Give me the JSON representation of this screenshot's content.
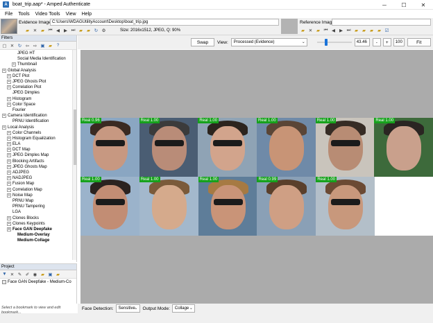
{
  "window": {
    "title": "boat_trip.aap* - Amped Authenticate",
    "logo": "A"
  },
  "menu": [
    "File",
    "Tools",
    "Video Tools",
    "View",
    "Help"
  ],
  "evidence": {
    "label": "Evidence Image:",
    "path": "C:\\Users\\WDAGUtilityAccount\\Desktop\\boat_trip.jpg",
    "size_info": "Size: 2016x1512, JPEG, Q: 90%"
  },
  "reference": {
    "label": "Reference Image:"
  },
  "filters": {
    "header": "Filters",
    "tree": [
      {
        "label": "JPEG HT",
        "level": 2,
        "exp": false
      },
      {
        "label": "Social Media Identification",
        "level": 2,
        "exp": false
      },
      {
        "label": "Thumbnail",
        "level": 2,
        "exp": true
      },
      {
        "label": "Global Analysis",
        "level": 0,
        "exp": true
      },
      {
        "label": "DCT Plot",
        "level": 1,
        "exp": true
      },
      {
        "label": "JPEG Ghosts Plot",
        "level": 1,
        "exp": true
      },
      {
        "label": "Correlation Plot",
        "level": 1,
        "exp": true
      },
      {
        "label": "JPEG Dimples",
        "level": 1,
        "exp": false
      },
      {
        "label": "Histogram",
        "level": 1,
        "exp": true
      },
      {
        "label": "Color Space",
        "level": 1,
        "exp": true
      },
      {
        "label": "Fourier",
        "level": 1,
        "exp": false
      },
      {
        "label": "Camera Identification",
        "level": 0,
        "exp": true
      },
      {
        "label": "PRNU Identification",
        "level": 1,
        "exp": false
      },
      {
        "label": "Local Analysis",
        "level": 0,
        "exp": true
      },
      {
        "label": "Color Channels",
        "level": 1,
        "exp": true
      },
      {
        "label": "Histogram Equalization",
        "level": 1,
        "exp": true
      },
      {
        "label": "ELA",
        "level": 1,
        "exp": true
      },
      {
        "label": "DCT Map",
        "level": 1,
        "exp": true
      },
      {
        "label": "JPEG Dimples Map",
        "level": 1,
        "exp": true
      },
      {
        "label": "Blocking Artifacts",
        "level": 1,
        "exp": true
      },
      {
        "label": "JPEG Ghosts Map",
        "level": 1,
        "exp": true
      },
      {
        "label": "ADJPEG",
        "level": 1,
        "exp": true
      },
      {
        "label": "NADJPEG",
        "level": 1,
        "exp": true
      },
      {
        "label": "Fusion Map",
        "level": 1,
        "exp": true
      },
      {
        "label": "Correlation Map",
        "level": 1,
        "exp": true
      },
      {
        "label": "Noise Map",
        "level": 1,
        "exp": true
      },
      {
        "label": "PRNU Map",
        "level": 1,
        "exp": false
      },
      {
        "label": "PRNU Tampering",
        "level": 1,
        "exp": false
      },
      {
        "label": "LGA",
        "level": 1,
        "exp": false
      },
      {
        "label": "Clones Blocks",
        "level": 1,
        "exp": true
      },
      {
        "label": "Clones Keypoints",
        "level": 1,
        "exp": true
      },
      {
        "label": "Face GAN Deepfake",
        "level": 1,
        "exp": true,
        "bold": true
      },
      {
        "label": "Medium-Overlay",
        "level": 2,
        "exp": false,
        "bold": true
      },
      {
        "label": "Medium-Collage",
        "level": 2,
        "exp": false,
        "bold": true
      }
    ]
  },
  "project": {
    "header": "Project",
    "item": "Face GAN Deepfake - Medium-Co",
    "hint": "Select a bookmark to view and edit bookmark..."
  },
  "view_toolbar": {
    "swap": "Swap",
    "view_label": "View:",
    "view_value": "Processed (Evidence)",
    "zoom": "43.46",
    "minus": "-",
    "plus": "+",
    "pct": "100",
    "fit": "Fit",
    "zoom_level": 0.25
  },
  "faces": [
    {
      "label": "Real 0.96",
      "skin": "#c79881",
      "hair": "#3a2a22",
      "glasses": true,
      "bg": "#8aa6c2"
    },
    {
      "label": "Real 1.00",
      "skin": "#b98c78",
      "hair": "#3b3b3b",
      "glasses": true,
      "bg": "#4a5d73"
    },
    {
      "label": "Real 1.00",
      "skin": "#d2a48c",
      "hair": "#2c241e",
      "glasses": true,
      "bg": "#8fa3b5"
    },
    {
      "label": "Real 1.00",
      "skin": "#c89476",
      "hair": "#5a4536",
      "glasses": false,
      "bg": "#6f8aa8"
    },
    {
      "label": "Real 1.00",
      "skin": "#b88c74",
      "hair": "#362c25",
      "glasses": true,
      "bg": "#c9c4bc"
    },
    {
      "label": "Real 1.00",
      "skin": "#c9a08c",
      "hair": "#2a2522",
      "glasses": false,
      "bg": "#3d6a3b"
    },
    {
      "label": "Real 1.00",
      "skin": "#c28d74",
      "hair": "#2b2320",
      "glasses": true,
      "bg": "#9bb3cb"
    },
    {
      "label": "Real 1.00",
      "skin": "#d5aa8c",
      "hair": "#7a5a3a",
      "glasses": false,
      "bg": "#a3b8cc"
    },
    {
      "label": "Real 1.00",
      "skin": "#c99478",
      "hair": "#a67a43",
      "glasses": true,
      "bg": "#5e7d99"
    },
    {
      "label": "Real 0.99",
      "skin": "#cf9f84",
      "hair": "#5a3f2b",
      "glasses": false,
      "bg": "#8aa0b6"
    },
    {
      "label": "Real 1.00",
      "skin": "#c8987c",
      "hair": "#6b4a34",
      "glasses": true,
      "bg": "#b3bfc9"
    }
  ],
  "status": {
    "face_detection_label": "Face Detection:",
    "face_detection_value": "Sensitive",
    "output_mode_label": "Output Mode:",
    "output_mode_value": "Collage"
  },
  "colors": {
    "accent": "#1a73d9",
    "real_badge": "#16a11c",
    "canvas_bg": "#ababab"
  }
}
